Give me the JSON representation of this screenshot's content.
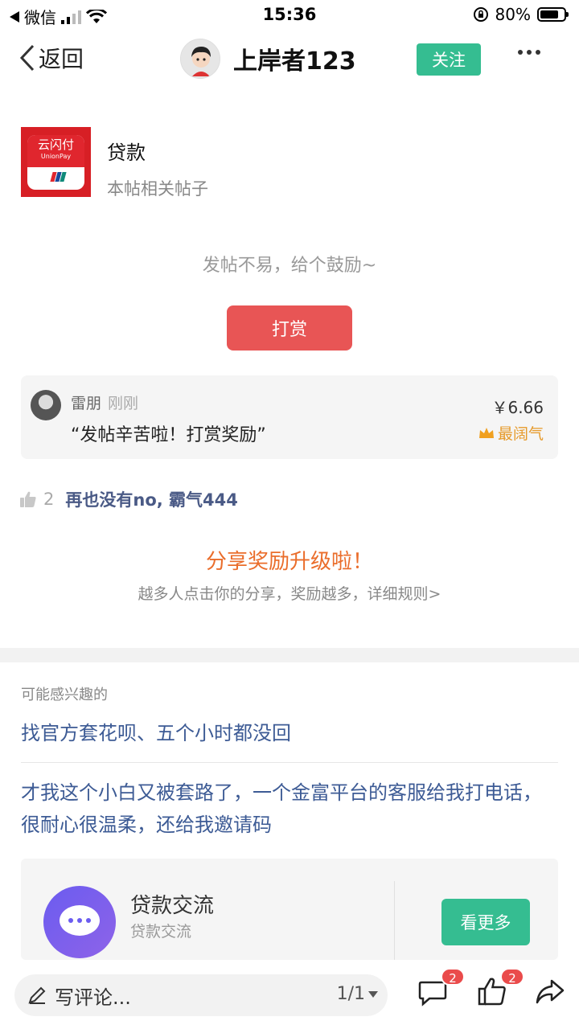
{
  "status_bar": {
    "carrier": "微信",
    "time": "15:36",
    "battery": "80%",
    "battery_level": 0.8
  },
  "nav": {
    "back_label": "返回",
    "author_name": "上岸者123",
    "follow_label": "关注"
  },
  "forum": {
    "logo_text": "云闪付",
    "logo_sub": "UnionPay",
    "title": "贷款",
    "subtitle": "本帖相关帖子"
  },
  "reward": {
    "tip": "发帖不易，给个鼓励~",
    "button_label": "打赏",
    "record": {
      "name": "雷朋",
      "time": "刚刚",
      "message": "“发帖辛苦啦！打赏奖励”",
      "amount": "￥6.66",
      "badge": "最阔气"
    }
  },
  "likes": {
    "count": "2",
    "names": "再也没有no, 霸气444"
  },
  "share": {
    "title": "分享奖励升级啦！",
    "subtitle": "越多人点击你的分享，奖励越多，详细规则>"
  },
  "interest": {
    "label": "可能感兴趣的",
    "items": [
      "找官方套花呗、五个小时都没回",
      "才我这个小白又被套路了，一个金富平台的客服给我打电话，很耐心很温柔，还给我邀请码"
    ]
  },
  "topic_card": {
    "title": "贷款交流",
    "subtitle": "贷款交流",
    "button_label": "看更多"
  },
  "bottom_bar": {
    "comment_placeholder": "写评论...",
    "page_indicator": "1/1",
    "comment_badge": "2",
    "like_badge": "2"
  },
  "colors": {
    "accent_green": "#35bd91",
    "reward_red": "#e85555",
    "link_blue": "#3d5b95",
    "share_orange": "#ea6d2b",
    "badge_red": "#ea4b4b"
  }
}
